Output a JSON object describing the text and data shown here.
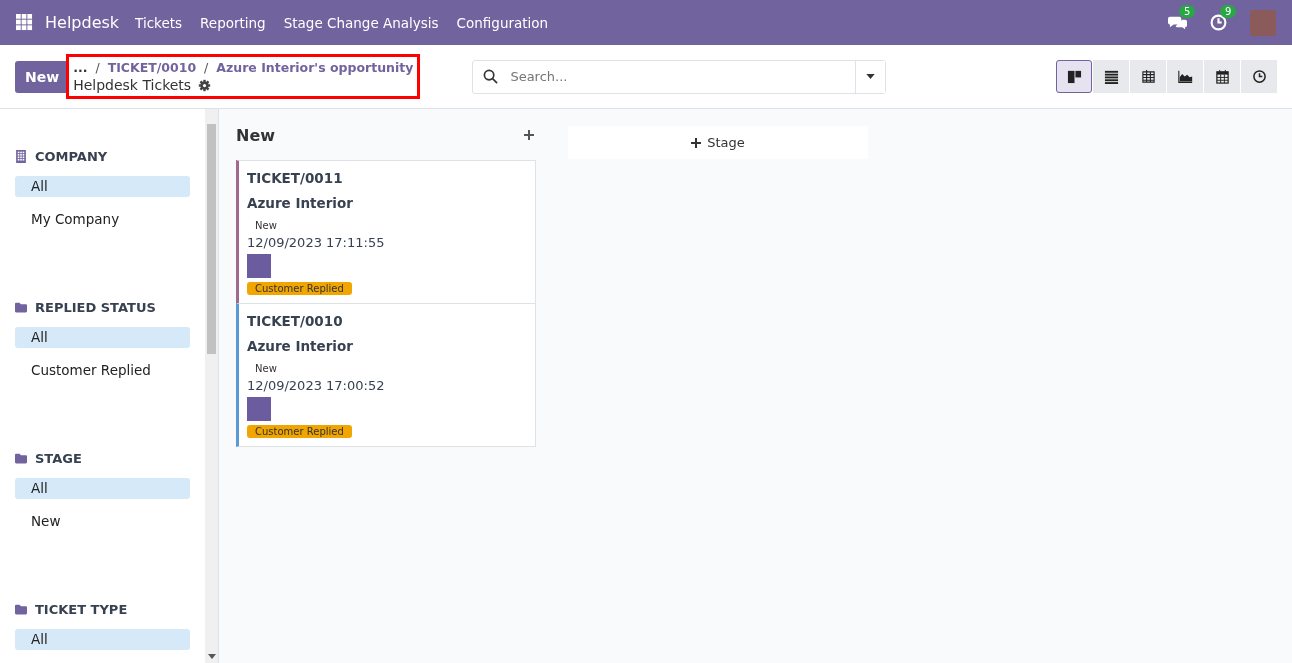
{
  "navbar": {
    "app_name": "Helpdesk",
    "menu": [
      "Tickets",
      "Reporting",
      "Stage Change Analysis",
      "Configuration"
    ],
    "messages_count": "5",
    "activities_count": "9"
  },
  "control_panel": {
    "new_button": "New",
    "breadcrumb_separator": "/",
    "breadcrumb": [
      "...",
      "TICKET/0010",
      "Azure Interior's opportunity"
    ],
    "title": "Helpdesk Tickets",
    "search": {
      "placeholder": "Search..."
    },
    "views": [
      {
        "kind": "kanban",
        "selected": true
      },
      {
        "kind": "list",
        "selected": false
      },
      {
        "kind": "pivot",
        "selected": false
      },
      {
        "kind": "graph",
        "selected": false
      },
      {
        "kind": "calendar",
        "selected": false
      },
      {
        "kind": "activity",
        "selected": false
      }
    ]
  },
  "sidebar": [
    {
      "kind": "company",
      "title": "COMPANY",
      "items": [
        {
          "label": "All",
          "selected": true
        },
        {
          "label": "My Company",
          "selected": false
        }
      ]
    },
    {
      "kind": "folder",
      "title": "REPLIED STATUS",
      "items": [
        {
          "label": "All",
          "selected": true
        },
        {
          "label": "Customer Replied",
          "selected": false
        }
      ]
    },
    {
      "kind": "folder",
      "title": "STAGE",
      "items": [
        {
          "label": "All",
          "selected": true
        },
        {
          "label": "New",
          "selected": false
        }
      ]
    },
    {
      "kind": "folder",
      "title": "TICKET TYPE",
      "items": [
        {
          "label": "All",
          "selected": true
        }
      ]
    }
  ],
  "kanban": {
    "columns": [
      {
        "title": "New",
        "cards": [
          {
            "ref": "TICKET/0011",
            "customer": "Azure Interior",
            "stage": "New",
            "date": "12/09/2023 17:11:55",
            "tag": "Customer Replied",
            "color": "#a06a8e"
          },
          {
            "ref": "TICKET/0010",
            "customer": "Azure Interior",
            "stage": "New",
            "date": "12/09/2023 17:00:52",
            "tag": "Customer Replied",
            "color": "#5b9bd5"
          }
        ]
      }
    ],
    "add_stage": "Stage"
  }
}
